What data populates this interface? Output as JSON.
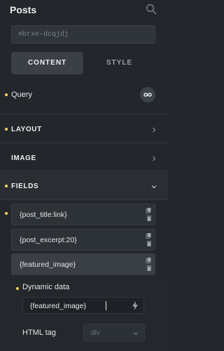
{
  "panel": {
    "title": "Posts",
    "element_id": "#brxe-dcqjdj"
  },
  "tabs": [
    {
      "label": "CONTENT"
    },
    {
      "label": "STYLE"
    }
  ],
  "query": {
    "label": "Query"
  },
  "sections": {
    "layout": "LAYOUT",
    "image": "IMAGE",
    "fields": "FIELDS"
  },
  "fields": [
    {
      "value": "{post_title:link}"
    },
    {
      "value": "{post_excerpt:20}"
    },
    {
      "value": "{featured_image}"
    }
  ],
  "field_settings": {
    "dynamic_data_label": "Dynamic data",
    "dynamic_data_value": "{featured_image}",
    "html_tag_label": "HTML tag",
    "html_tag_placeholder": "div"
  },
  "colors": {
    "accent": "#ffd64f",
    "panel_bg": "#23272c",
    "active_tab": "#3b4047"
  },
  "icons": [
    "search-icon",
    "infinity-icon",
    "chevron-right-icon",
    "chevron-down-icon",
    "copy-icon",
    "trash-icon",
    "bolt-icon"
  ]
}
